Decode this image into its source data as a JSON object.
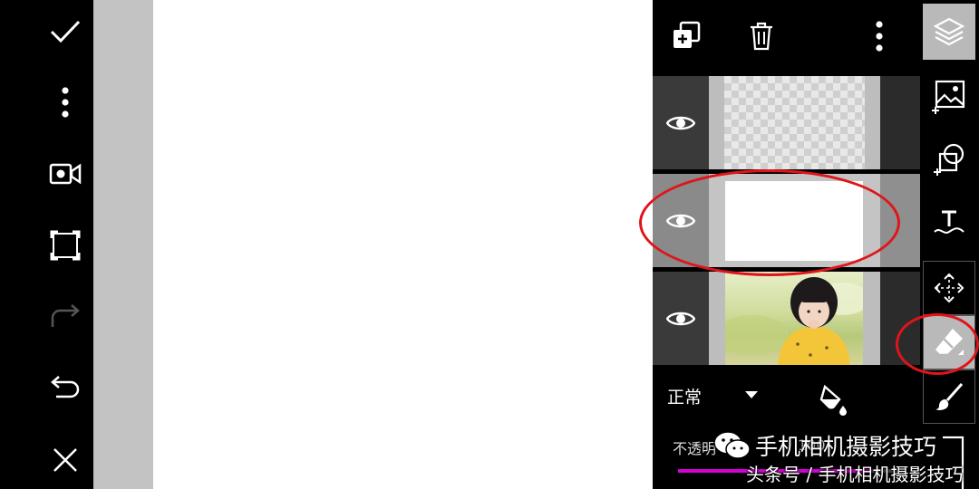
{
  "left_toolbar": {
    "tools": [
      {
        "icon": "check-icon"
      },
      {
        "icon": "more-vertical-icon"
      },
      {
        "icon": "video-record-icon"
      },
      {
        "icon": "fit-screen-icon"
      },
      {
        "icon": "redo-icon",
        "disabled": true
      },
      {
        "icon": "undo-icon"
      },
      {
        "icon": "close-icon"
      }
    ]
  },
  "layers_panel": {
    "top_actions": [
      {
        "icon": "add-layer-icon"
      },
      {
        "icon": "trash-icon"
      },
      {
        "icon": "more-vertical-icon"
      }
    ],
    "layers": [
      {
        "type": "transparent",
        "visible": true,
        "selected": false
      },
      {
        "type": "white",
        "visible": true,
        "selected": true
      },
      {
        "type": "photo",
        "visible": true,
        "selected": false
      }
    ],
    "blend_mode": "正常",
    "opacity_label": "不透明",
    "opacity_value": "100",
    "opacity_fraction": 1.0
  },
  "right_toolbar": {
    "tools": [
      {
        "icon": "layers-icon",
        "active": true
      },
      {
        "icon": "add-image-icon"
      },
      {
        "icon": "add-sticker-icon"
      },
      {
        "icon": "add-text-icon"
      },
      {
        "icon": "move-icon"
      },
      {
        "icon": "eraser-icon",
        "active": true
      },
      {
        "icon": "brush-icon"
      }
    ]
  },
  "watermark": {
    "title": "手机相机摄影技巧",
    "subtitle": "头条号 / 手机相机摄影技巧"
  },
  "colors": {
    "accent": "#d400d4",
    "annotation": "#e0141a",
    "canvas": "#ffffff"
  }
}
